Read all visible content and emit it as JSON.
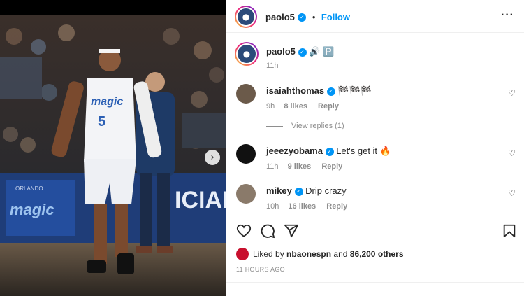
{
  "post": {
    "image": {
      "alt_description": "",
      "jersey_text": "magic",
      "jersey_number": "5",
      "banner_left": "ORLANDO",
      "banner_left_logo": "magic",
      "banner_right": "ICIAL"
    }
  },
  "header": {
    "username": "paolo5",
    "separator": "•",
    "follow_label": "Follow",
    "more_label": "···"
  },
  "caption": {
    "username": "paolo5",
    "text": "🔊 🅿️",
    "time": "11h"
  },
  "comments": [
    {
      "username": "isaiahthomas",
      "text": "🏁🏁🏁",
      "time": "9h",
      "likes": "8 likes",
      "reply_label": "Reply"
    },
    {
      "username": "jeeezyobama",
      "text": "Let's get it 🔥",
      "time": "11h",
      "likes": "9 likes",
      "reply_label": "Reply"
    },
    {
      "username": "mikey",
      "text": "Drip crazy",
      "time": "10h",
      "likes": "16 likes",
      "reply_label": "Reply"
    }
  ],
  "view_replies_label": "View replies (1)",
  "likes_line": {
    "prefix": "Liked by",
    "user": "nbaonespn",
    "middle": "and",
    "count": "86,200 others"
  },
  "post_time": "11 HOURS AGO",
  "icons": {
    "like": "heart-icon",
    "comment": "comment-icon",
    "share": "share-icon",
    "save": "bookmark-icon",
    "next": "chevron-right-icon"
  },
  "colors": {
    "accent": "#0095f6",
    "muted": "#8e8e8e",
    "text": "#262626"
  }
}
